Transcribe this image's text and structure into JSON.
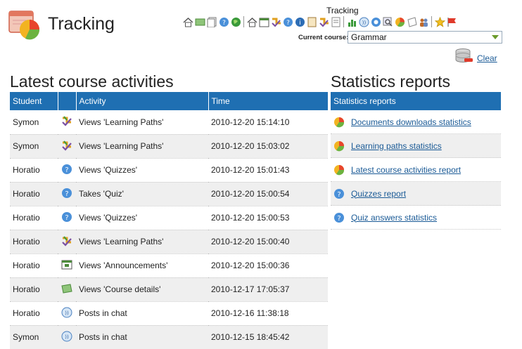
{
  "app": {
    "title": "Tracking"
  },
  "toolbar": {
    "title": "Tracking",
    "icons": [
      "home-icon",
      "course-details-icon",
      "documents-icon",
      "quizzes-icon",
      "globe-icon",
      "home-icon",
      "announcements-icon",
      "learning-paths-icon",
      "quiz-icon",
      "help-icon",
      "links-icon",
      "learning-paths-icon",
      "stats-icon",
      "chat-icon",
      "forum-icon",
      "search-icon",
      "reports-icon",
      "notes-icon",
      "users-icon",
      "favorites-icon",
      "flag-icon"
    ]
  },
  "course": {
    "label": "Current course:",
    "selected": "Grammar"
  },
  "clear": {
    "label": "Clear"
  },
  "activities": {
    "heading": "Latest course activities",
    "columns": [
      "Student",
      "",
      "Activity",
      "Time"
    ],
    "rows": [
      {
        "student": "Symon",
        "icon": "learning-paths-icon",
        "activity": "Views 'Learning Paths'",
        "time": "2010-12-20 15:14:10"
      },
      {
        "student": "Symon",
        "icon": "learning-paths-icon",
        "activity": "Views 'Learning Paths'",
        "time": "2010-12-20 15:03:02"
      },
      {
        "student": "Horatio",
        "icon": "quizzes-icon",
        "activity": "Views 'Quizzes'",
        "time": "2010-12-20 15:01:43"
      },
      {
        "student": "Horatio",
        "icon": "quizzes-icon",
        "activity": "Takes 'Quiz'",
        "time": "2010-12-20 15:00:54"
      },
      {
        "student": "Horatio",
        "icon": "quizzes-icon",
        "activity": "Views 'Quizzes'",
        "time": "2010-12-20 15:00:53"
      },
      {
        "student": "Horatio",
        "icon": "learning-paths-icon",
        "activity": "Views 'Learning Paths'",
        "time": "2010-12-20 15:00:40"
      },
      {
        "student": "Horatio",
        "icon": "announcements-icon",
        "activity": "Views 'Announcements'",
        "time": "2010-12-20 15:00:36"
      },
      {
        "student": "Horatio",
        "icon": "course-details-icon",
        "activity": "Views 'Course details'",
        "time": "2010-12-17 17:05:37"
      },
      {
        "student": "Horatio",
        "icon": "chat-icon",
        "activity": "Posts in chat",
        "time": "2010-12-16 11:38:18"
      },
      {
        "student": "Symon",
        "icon": "chat-icon",
        "activity": "Posts in chat",
        "time": "2010-12-15 18:45:42"
      }
    ]
  },
  "stats": {
    "heading": "Statistics reports",
    "header": "Statistics reports",
    "items": [
      {
        "label": "Documents downloads statistics",
        "icon": "pie-chart-icon"
      },
      {
        "label": "Learning paths statistics",
        "icon": "pie-chart-icon"
      },
      {
        "label": "Latest course activities report",
        "icon": "pie-chart-icon"
      },
      {
        "label": "Quizzes report",
        "icon": "quizzes-icon"
      },
      {
        "label": "Quiz answers statistics",
        "icon": "quizzes-icon"
      }
    ]
  },
  "colors": {
    "header_blue": "#1f6fb2",
    "link_blue": "#1a5a96",
    "alt_row": "#efefef"
  }
}
